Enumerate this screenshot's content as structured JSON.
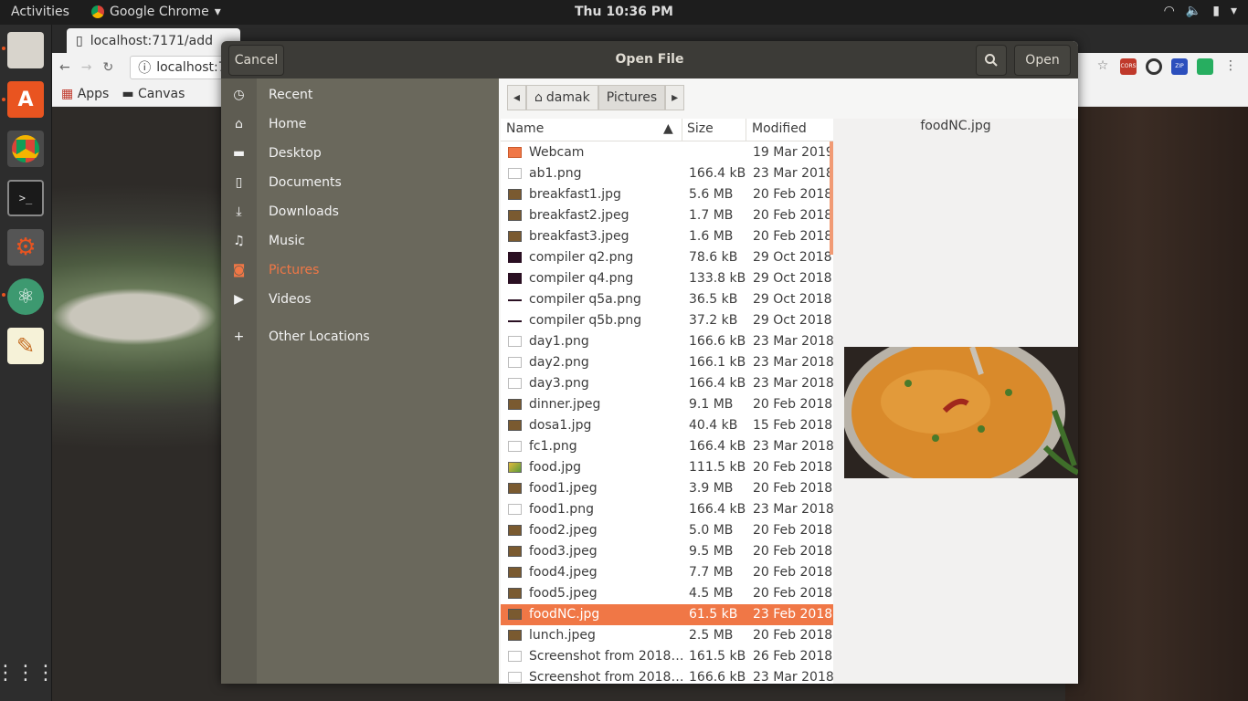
{
  "topbar": {
    "activities": "Activities",
    "app_name": "Google Chrome",
    "clock": "Thu 10:36 PM"
  },
  "chrome": {
    "tab_title": "localhost:7171/add",
    "url": "localhost:7",
    "bookmarks": {
      "apps": "Apps",
      "canvas": "Canvas"
    },
    "extensions": [
      "CORS",
      "ZIP"
    ]
  },
  "dialog": {
    "title": "Open File",
    "cancel_label": "Cancel",
    "open_label": "Open",
    "sidebar": [
      {
        "label": "Recent",
        "icon": "clock-icon"
      },
      {
        "label": "Home",
        "icon": "home-icon"
      },
      {
        "label": "Desktop",
        "icon": "folder-icon"
      },
      {
        "label": "Documents",
        "icon": "document-icon"
      },
      {
        "label": "Downloads",
        "icon": "download-icon"
      },
      {
        "label": "Music",
        "icon": "music-icon"
      },
      {
        "label": "Pictures",
        "icon": "camera-icon",
        "active": true
      },
      {
        "label": "Videos",
        "icon": "video-icon"
      },
      {
        "label": "Other Locations",
        "icon": "plus-icon"
      }
    ],
    "path": [
      "damak",
      "Pictures"
    ],
    "columns": {
      "name": "Name",
      "size": "Size",
      "modified": "Modified"
    },
    "files": [
      {
        "name": "Webcam",
        "size": "",
        "modified": "19 Mar 2019",
        "kind": "folder"
      },
      {
        "name": "ab1.png",
        "size": "166.4 kB",
        "modified": "23 Mar 2018",
        "kind": "blank"
      },
      {
        "name": "breakfast1.jpg",
        "size": "5.6 MB",
        "modified": "20 Feb 2018",
        "kind": "photo"
      },
      {
        "name": "breakfast2.jpeg",
        "size": "1.7 MB",
        "modified": "20 Feb 2018",
        "kind": "photo"
      },
      {
        "name": "breakfast3.jpeg",
        "size": "1.6 MB",
        "modified": "20 Feb 2018",
        "kind": "photo"
      },
      {
        "name": "compiler q2.png",
        "size": "78.6 kB",
        "modified": "29 Oct 2018",
        "kind": "dark"
      },
      {
        "name": "compiler q4.png",
        "size": "133.8 kB",
        "modified": "29 Oct 2018",
        "kind": "dark"
      },
      {
        "name": "compiler q5a.png",
        "size": "36.5 kB",
        "modified": "29 Oct 2018",
        "kind": "line"
      },
      {
        "name": "compiler q5b.png",
        "size": "37.2 kB",
        "modified": "29 Oct 2018",
        "kind": "line"
      },
      {
        "name": "day1.png",
        "size": "166.6 kB",
        "modified": "23 Mar 2018",
        "kind": "blank"
      },
      {
        "name": "day2.png",
        "size": "166.1 kB",
        "modified": "23 Mar 2018",
        "kind": "blank"
      },
      {
        "name": "day3.png",
        "size": "166.4 kB",
        "modified": "23 Mar 2018",
        "kind": "blank"
      },
      {
        "name": "dinner.jpeg",
        "size": "9.1 MB",
        "modified": "20 Feb 2018",
        "kind": "photo"
      },
      {
        "name": "dosa1.jpg",
        "size": "40.4 kB",
        "modified": "15 Feb 2018",
        "kind": "photo"
      },
      {
        "name": "fc1.png",
        "size": "166.4 kB",
        "modified": "23 Mar 2018",
        "kind": "blank"
      },
      {
        "name": "food.jpg",
        "size": "111.5 kB",
        "modified": "20 Feb 2018",
        "kind": "color"
      },
      {
        "name": "food1.jpeg",
        "size": "3.9 MB",
        "modified": "20 Feb 2018",
        "kind": "photo"
      },
      {
        "name": "food1.png",
        "size": "166.4 kB",
        "modified": "23 Mar 2018",
        "kind": "blank"
      },
      {
        "name": "food2.jpeg",
        "size": "5.0 MB",
        "modified": "20 Feb 2018",
        "kind": "photo"
      },
      {
        "name": "food3.jpeg",
        "size": "9.5 MB",
        "modified": "20 Feb 2018",
        "kind": "photo"
      },
      {
        "name": "food4.jpeg",
        "size": "7.7 MB",
        "modified": "20 Feb 2018",
        "kind": "photo"
      },
      {
        "name": "food5.jpeg",
        "size": "4.5 MB",
        "modified": "20 Feb 2018",
        "kind": "photo"
      },
      {
        "name": "foodNC.jpg",
        "size": "61.5 kB",
        "modified": "23 Feb 2018",
        "kind": "photo",
        "selected": true
      },
      {
        "name": "lunch.jpeg",
        "size": "2.5 MB",
        "modified": "20 Feb 2018",
        "kind": "photo"
      },
      {
        "name": "Screenshot from 2018…",
        "size": "161.5 kB",
        "modified": "26 Feb 2018",
        "kind": "blank"
      },
      {
        "name": "Screenshot from 2018…",
        "size": "166.6 kB",
        "modified": "23 Mar 2018",
        "kind": "blank"
      }
    ],
    "preview_name": "foodNC.jpg"
  },
  "colors": {
    "accent": "#f07746",
    "sidebar": "#6a685c",
    "header": "#3c3b37"
  }
}
